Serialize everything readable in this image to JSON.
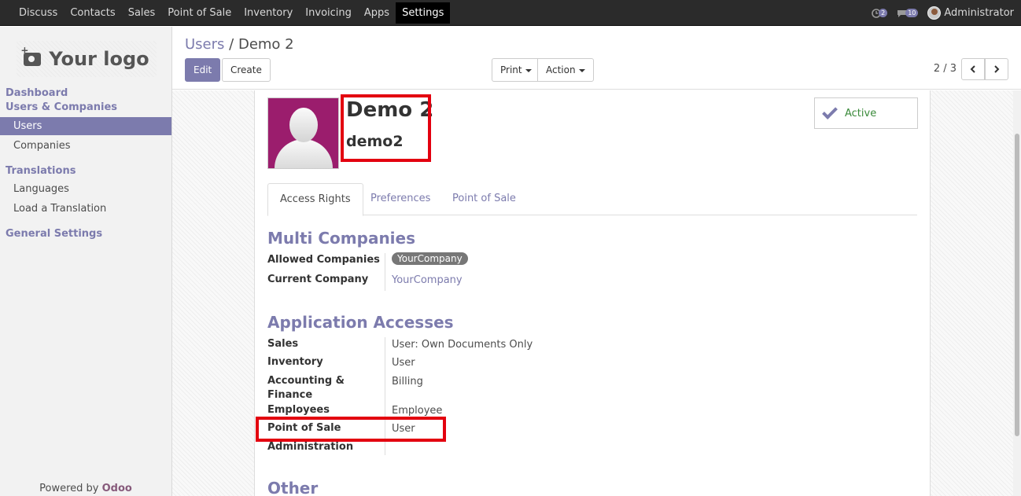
{
  "topbar": {
    "menu": [
      "Discuss",
      "Contacts",
      "Sales",
      "Point of Sale",
      "Inventory",
      "Invoicing",
      "Apps",
      "Settings"
    ],
    "active_menu": "Settings",
    "activity_count": "2",
    "messages_count": "10",
    "user_name": "Administrator"
  },
  "sidebar": {
    "logo_text": "Your logo",
    "dashboard": "Dashboard",
    "users_companies": "Users & Companies",
    "users": "Users",
    "companies": "Companies",
    "translations": "Translations",
    "languages": "Languages",
    "load_translation": "Load a Translation",
    "general_settings": "General Settings",
    "powered_by": "Powered by",
    "powered_brand": "Odoo"
  },
  "control_panel": {
    "breadcrumb_parent": "Users",
    "breadcrumb_sep": "/",
    "breadcrumb_current": "Demo 2",
    "edit_label": "Edit",
    "create_label": "Create",
    "print_label": "Print",
    "action_label": "Action",
    "pager": "2 / 3"
  },
  "form": {
    "name": "Demo 2",
    "login": "demo2",
    "active_label": "Active",
    "tabs": [
      "Access Rights",
      "Preferences",
      "Point of Sale"
    ],
    "multi_companies": {
      "title": "Multi Companies",
      "allowed_label": "Allowed Companies",
      "allowed_value": "YourCompany",
      "current_label": "Current Company",
      "current_value": "YourCompany"
    },
    "app_access": {
      "title": "Application Accesses",
      "rows": [
        {
          "label": "Sales",
          "value": "User: Own Documents Only"
        },
        {
          "label": "Inventory",
          "value": "User"
        },
        {
          "label": "Accounting & Finance",
          "value": "Billing"
        },
        {
          "label": "Employees",
          "value": "Employee"
        },
        {
          "label": "Point of Sale",
          "value": "User"
        },
        {
          "label": "Administration",
          "value": ""
        }
      ]
    },
    "other_title": "Other"
  },
  "colors": {
    "brand": "#7c7bad",
    "highlight": "#e3000f"
  }
}
